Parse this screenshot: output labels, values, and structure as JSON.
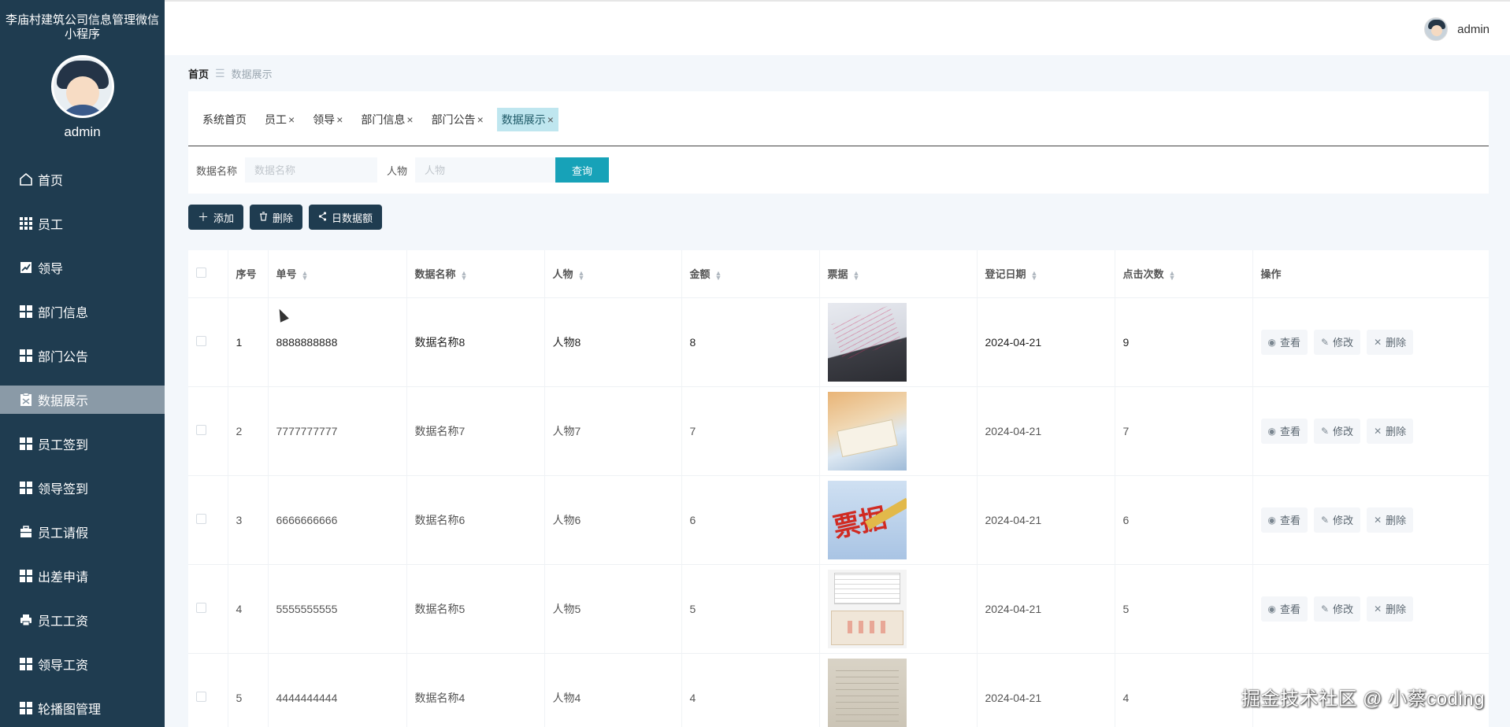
{
  "sidebar": {
    "app_title": "李庙村建筑公司信息管理微信小程序",
    "user_name": "admin",
    "items": [
      {
        "label": "首页",
        "icon": "home-icon"
      },
      {
        "label": "员工",
        "icon": "grid-icon"
      },
      {
        "label": "领导",
        "icon": "chart-icon"
      },
      {
        "label": "部门信息",
        "icon": "grid-icon"
      },
      {
        "label": "部门公告",
        "icon": "grid-icon"
      },
      {
        "label": "数据展示",
        "icon": "clipboard-icon",
        "active": true
      },
      {
        "label": "员工签到",
        "icon": "grid-icon"
      },
      {
        "label": "领导签到",
        "icon": "grid-icon"
      },
      {
        "label": "员工请假",
        "icon": "briefcase-icon"
      },
      {
        "label": "出差申请",
        "icon": "grid-icon"
      },
      {
        "label": "员工工资",
        "icon": "printer-icon"
      },
      {
        "label": "领导工资",
        "icon": "grid-icon"
      },
      {
        "label": "轮播图管理",
        "icon": "grid-icon"
      }
    ]
  },
  "header": {
    "user_name": "admin"
  },
  "breadcrumb": {
    "home": "首页",
    "separator": "☰",
    "current": "数据展示"
  },
  "tabs": [
    {
      "label": "系统首页",
      "closable": false
    },
    {
      "label": "员工",
      "closable": true
    },
    {
      "label": "领导",
      "closable": true
    },
    {
      "label": "部门信息",
      "closable": true
    },
    {
      "label": "部门公告",
      "closable": true
    },
    {
      "label": "数据展示",
      "closable": true,
      "active": true
    }
  ],
  "tab_close": "×",
  "search": {
    "name_label": "数据名称",
    "name_placeholder": "数据名称",
    "person_label": "人物",
    "person_placeholder": "人物",
    "query_button": "查询"
  },
  "actions": {
    "add": "添加",
    "delete": "删除",
    "daily_amount": "日数据额"
  },
  "table": {
    "headers": [
      "序号",
      "单号",
      "数据名称",
      "人物",
      "金额",
      "票据",
      "登记日期",
      "点击次数",
      "操作"
    ],
    "rows": [
      {
        "index": "1",
        "order_no": "8888888888",
        "name": "数据名称8",
        "person": "人物8",
        "amount": "8",
        "date": "2024-04-21",
        "clicks": "9"
      },
      {
        "index": "2",
        "order_no": "7777777777",
        "name": "数据名称7",
        "person": "人物7",
        "amount": "7",
        "date": "2024-04-21",
        "clicks": "7"
      },
      {
        "index": "3",
        "order_no": "6666666666",
        "name": "数据名称6",
        "person": "人物6",
        "amount": "6",
        "date": "2024-04-21",
        "clicks": "6"
      },
      {
        "index": "4",
        "order_no": "5555555555",
        "name": "数据名称5",
        "person": "人物5",
        "amount": "5",
        "date": "2024-04-21",
        "clicks": "5"
      },
      {
        "index": "5",
        "order_no": "4444444444",
        "name": "数据名称4",
        "person": "人物4",
        "amount": "4",
        "date": "2024-04-21",
        "clicks": "4"
      }
    ],
    "row_ops": {
      "view": "查看",
      "edit": "修改",
      "delete": "删除"
    }
  },
  "watermark": "掘金技术社区 @ 小蔡coding",
  "colors": {
    "sidebar_bg": "#1f3c50",
    "active_menu_bg": "#8a9aa7",
    "query_button": "#17a2b8",
    "active_tab_bg": "#bfe6ef"
  }
}
